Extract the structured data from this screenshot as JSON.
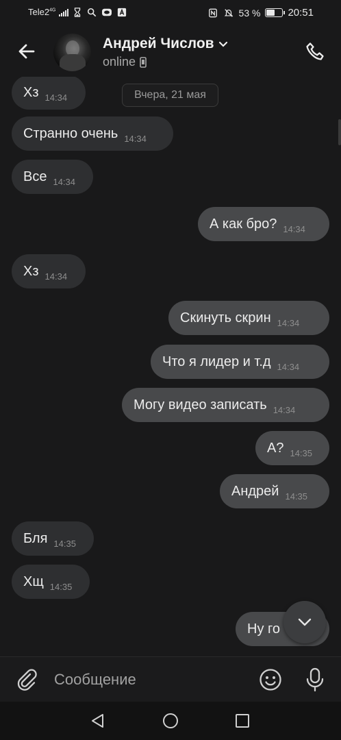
{
  "status_bar": {
    "carrier": "Tele2",
    "network": "4G",
    "battery_percent_label": "53 %",
    "battery_level": 0.53,
    "time": "20:51",
    "icons": [
      "signal-icon",
      "hourglass-icon",
      "search-icon",
      "vpn-icon",
      "a-icon",
      "nfc-icon",
      "mute-icon",
      "battery-icon"
    ]
  },
  "header": {
    "contact_name": "Андрей Числов",
    "status": "online",
    "icons": [
      "back-arrow-icon",
      "chevron-down-icon",
      "phone-device-icon",
      "phone-call-icon"
    ]
  },
  "chat": {
    "date_separator": "Вчера, 21 мая",
    "messages": [
      {
        "dir": "in",
        "text": "Хз",
        "time": "14:34"
      },
      {
        "dir": "in",
        "text": "Странно очень",
        "time": "14:34"
      },
      {
        "dir": "in",
        "text": "Все",
        "time": "14:34"
      },
      {
        "dir": "out",
        "text": "А как бро?",
        "time": "14:34"
      },
      {
        "dir": "in",
        "text": "Хз",
        "time": "14:34"
      },
      {
        "dir": "out",
        "text": "Скинуть скрин",
        "time": "14:34"
      },
      {
        "dir": "out",
        "text": "Что я лидер и т.д",
        "time": "14:34"
      },
      {
        "dir": "out",
        "text": "Могу видео записать",
        "time": "14:34"
      },
      {
        "dir": "out",
        "text": "А?",
        "time": "14:35"
      },
      {
        "dir": "out",
        "text": "Андрей",
        "time": "14:35"
      },
      {
        "dir": "in",
        "text": "Бля",
        "time": "14:35"
      },
      {
        "dir": "in",
        "text": "Хщ",
        "time": "14:35"
      },
      {
        "dir": "out",
        "text": "Ну го",
        "time": ""
      }
    ]
  },
  "composer": {
    "placeholder": "Сообщение",
    "icons": [
      "paperclip-icon",
      "emoji-icon",
      "microphone-icon"
    ]
  },
  "nav_bar": {
    "icons": [
      "nav-back-icon",
      "nav-home-icon",
      "nav-recents-icon"
    ]
  },
  "colors": {
    "background": "#19191a",
    "incoming_bubble": "#2e2f31",
    "outgoing_bubble": "#48494b",
    "text": "#ececec",
    "timestamp": "#8e8e8e"
  }
}
